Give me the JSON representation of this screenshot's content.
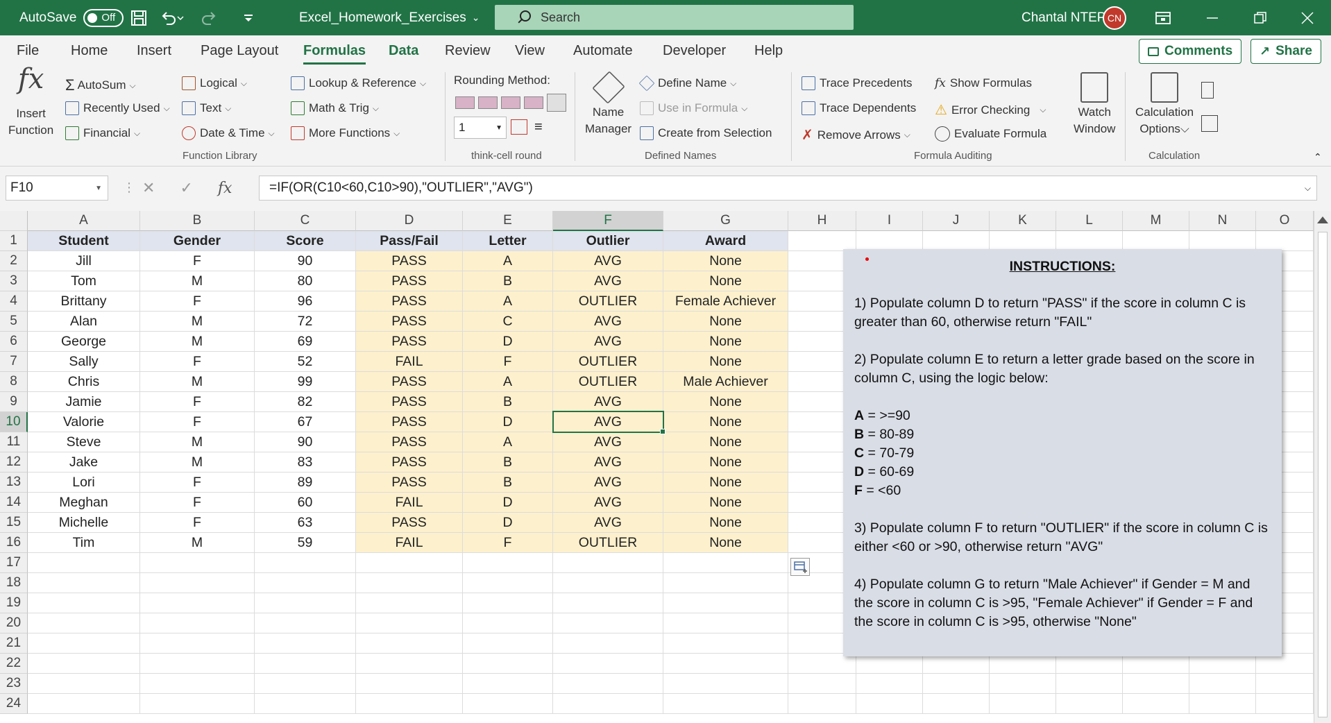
{
  "titlebar": {
    "autosave_label": "AutoSave",
    "autosave_state": "Off",
    "file_name": "Excel_Homework_Exercises",
    "search_placeholder": "Search",
    "user_name": "Chantal NTEP",
    "user_initials": "CN"
  },
  "menu": {
    "tabs": [
      "File",
      "Home",
      "Insert",
      "Page Layout",
      "Formulas",
      "Data",
      "Review",
      "View",
      "Automate",
      "Developer",
      "Help"
    ],
    "active_tab": "Formulas",
    "comments_label": "Comments",
    "share_label": "Share"
  },
  "ribbon": {
    "insert_function": [
      "Insert",
      "Function"
    ],
    "autosum": "AutoSum",
    "recently_used": "Recently Used",
    "financial": "Financial",
    "logical": "Logical",
    "text": "Text",
    "date_time": "Date & Time",
    "lookup": "Lookup & Reference",
    "math_trig": "Math & Trig",
    "more_functions": "More Functions",
    "group_function_library": "Function Library",
    "rounding_method": "Rounding Method:",
    "rounding_value": "1",
    "group_think_cell": "think-cell round",
    "name_manager": [
      "Name",
      "Manager"
    ],
    "define_name": "Define Name",
    "use_in_formula": "Use in Formula",
    "create_from_selection": "Create from Selection",
    "group_defined_names": "Defined Names",
    "trace_precedents": "Trace Precedents",
    "trace_dependents": "Trace Dependents",
    "remove_arrows": "Remove Arrows",
    "show_formulas": "Show Formulas",
    "error_checking": "Error Checking",
    "evaluate_formula": "Evaluate Formula",
    "watch_window": [
      "Watch",
      "Window"
    ],
    "group_formula_auditing": "Formula Auditing",
    "calculation_options": [
      "Calculation",
      "Options"
    ],
    "group_calculation": "Calculation"
  },
  "formula_bar": {
    "name_box": "F10",
    "formula": "=IF(OR(C10<60,C10>90),\"OUTLIER\",\"AVG\")"
  },
  "grid": {
    "columns": [
      "A",
      "B",
      "C",
      "D",
      "E",
      "F",
      "G",
      "H",
      "I",
      "J",
      "K",
      "L",
      "M",
      "N",
      "O"
    ],
    "rows": [
      "1",
      "2",
      "3",
      "4",
      "5",
      "6",
      "7",
      "8",
      "9",
      "10",
      "11",
      "12",
      "13",
      "14",
      "15",
      "16",
      "17",
      "18",
      "19",
      "20",
      "21",
      "22",
      "23",
      "24"
    ],
    "selected_cell": "F10",
    "headers": [
      "Student",
      "Gender",
      "Score",
      "Pass/Fail",
      "Letter",
      "Outlier",
      "Award"
    ],
    "data": [
      [
        "Jill",
        "F",
        "90",
        "PASS",
        "A",
        "AVG",
        "None"
      ],
      [
        "Tom",
        "M",
        "80",
        "PASS",
        "B",
        "AVG",
        "None"
      ],
      [
        "Brittany",
        "F",
        "96",
        "PASS",
        "A",
        "OUTLIER",
        "Female Achiever"
      ],
      [
        "Alan",
        "M",
        "72",
        "PASS",
        "C",
        "AVG",
        "None"
      ],
      [
        "George",
        "M",
        "69",
        "PASS",
        "D",
        "AVG",
        "None"
      ],
      [
        "Sally",
        "F",
        "52",
        "FAIL",
        "F",
        "OUTLIER",
        "None"
      ],
      [
        "Chris",
        "M",
        "99",
        "PASS",
        "A",
        "OUTLIER",
        "Male Achiever"
      ],
      [
        "Jamie",
        "F",
        "82",
        "PASS",
        "B",
        "AVG",
        "None"
      ],
      [
        "Valorie",
        "F",
        "67",
        "PASS",
        "D",
        "AVG",
        "None"
      ],
      [
        "Steve",
        "M",
        "90",
        "PASS",
        "A",
        "AVG",
        "None"
      ],
      [
        "Jake",
        "M",
        "83",
        "PASS",
        "B",
        "AVG",
        "None"
      ],
      [
        "Lori",
        "F",
        "89",
        "PASS",
        "B",
        "AVG",
        "None"
      ],
      [
        "Meghan",
        "F",
        "60",
        "FAIL",
        "D",
        "AVG",
        "None"
      ],
      [
        "Michelle",
        "F",
        "63",
        "PASS",
        "D",
        "AVG",
        "None"
      ],
      [
        "Tim",
        "M",
        "59",
        "FAIL",
        "F",
        "OUTLIER",
        "None"
      ]
    ]
  },
  "instructions": {
    "title": "INSTRUCTIONS:",
    "step1": "1) Populate column D to return \"PASS\" if the score in column C is greater than 60, otherwise return \"FAIL\"",
    "step2": "2) Populate column E to return a letter grade based on the score in column C, using the logic below:",
    "grades": [
      {
        "letter": "A",
        "rule": " = >=90"
      },
      {
        "letter": "B",
        "rule": " = 80-89"
      },
      {
        "letter": "C",
        "rule": " = 70-79"
      },
      {
        "letter": "D",
        "rule": " = 60-69"
      },
      {
        "letter": "F",
        "rule": " = <60"
      }
    ],
    "step3": "3) Populate column F to return \"OUTLIER\" if the score in column C is either <60 or >90, otherwise return \"AVG\"",
    "step4": "4) Populate column G to return \"Male Achiever\" if Gender = M and the score in column C is >95, \"Female Achiever\" if Gender = F and the score in column C is >95, otherwise \"None\""
  }
}
